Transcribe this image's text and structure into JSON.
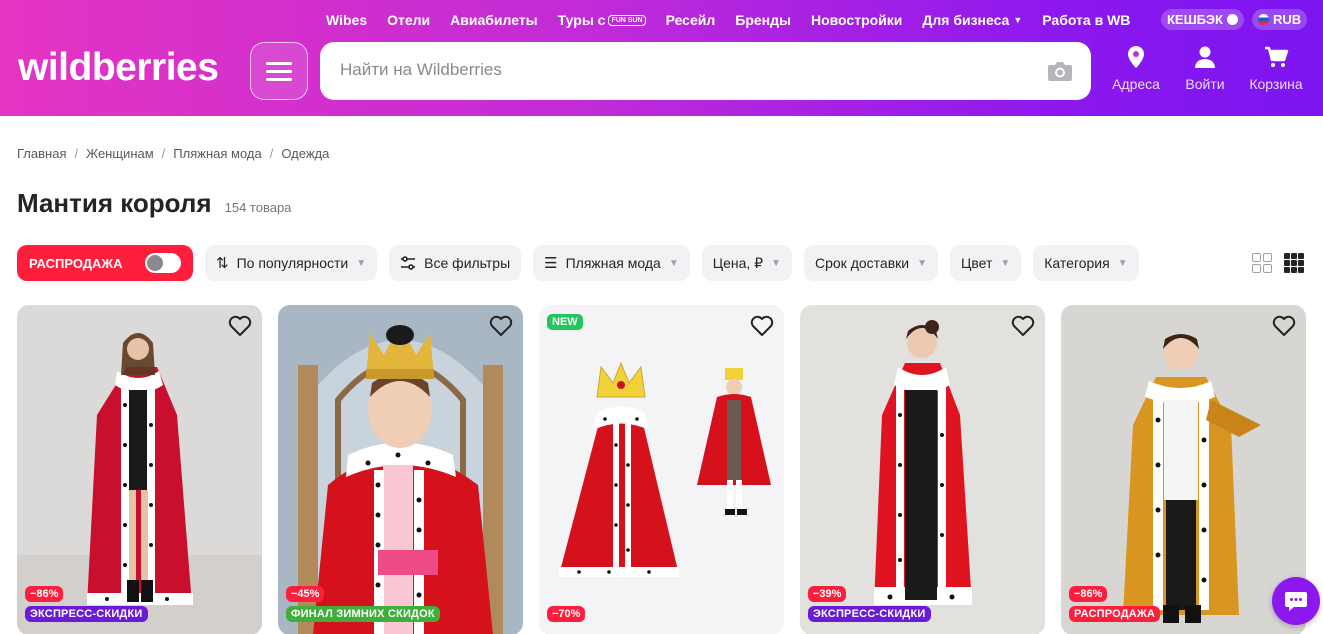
{
  "header": {
    "logo_text": "wildberries",
    "search_placeholder": "Найти на Wildberries",
    "top_nav": [
      {
        "label": "Wibes"
      },
      {
        "label": "Отели"
      },
      {
        "label": "Авиабилеты"
      },
      {
        "label": "Туры с",
        "badge": "FUN SUN"
      },
      {
        "label": "Ресейл"
      },
      {
        "label": "Бренды"
      },
      {
        "label": "Новостройки"
      },
      {
        "label": "Для бизнеса"
      },
      {
        "label": "Работа в WB"
      }
    ],
    "cashback_label": "КЕШБЭК",
    "currency_label": "RUB",
    "actions": {
      "address": "Адреса",
      "login": "Войти",
      "cart": "Корзина"
    },
    "colors": {
      "gradient_start": "#e434c2",
      "gradient_end": "#7b15f0"
    }
  },
  "breadcrumb": [
    "Главная",
    "Женщинам",
    "Пляжная мода",
    "Одежда"
  ],
  "page": {
    "title": "Мантия короля",
    "count": "154 товара"
  },
  "filters": {
    "sale_label": "РАСПРОДАЖА",
    "sort_label": "По популярности",
    "all_filters_label": "Все фильтры",
    "category_chip": "Пляжная мода",
    "price_label": "Цена, ₽",
    "delivery_label": "Срок доставки",
    "color_label": "Цвет",
    "category_label": "Категория"
  },
  "products": [
    {
      "discount": "−86%",
      "promo": "ЭКСПРЕСС-СКИДКИ",
      "promo_color": "#6b1bd6",
      "new": ""
    },
    {
      "discount": "−45%",
      "promo": "ФИНАЛ ЗИМНИХ СКИДОК",
      "promo_color": "#3fae3a",
      "new": ""
    },
    {
      "discount": "−70%",
      "promo": "",
      "promo_color": "",
      "new": "NEW"
    },
    {
      "discount": "−39%",
      "promo": "ЭКСПРЕСС-СКИДКИ",
      "promo_color": "#6b1bd6",
      "new": ""
    },
    {
      "discount": "−86%",
      "promo": "РАСПРОДАЖА",
      "promo_color": "#ff1f3d",
      "new": ""
    }
  ]
}
